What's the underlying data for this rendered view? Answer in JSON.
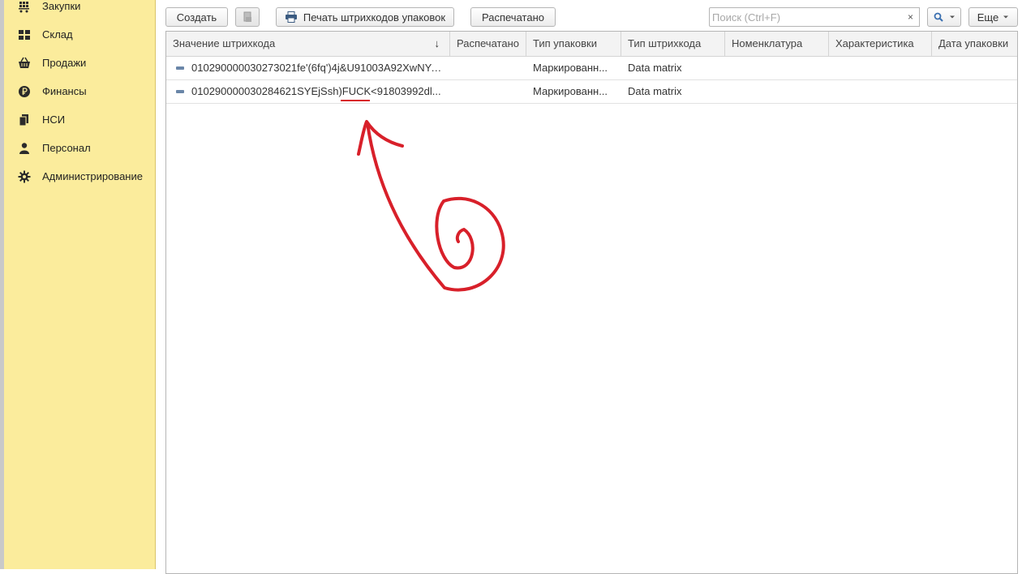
{
  "sidebar": {
    "items": [
      {
        "label": "Закупки",
        "icon": "cart-icon"
      },
      {
        "label": "Склад",
        "icon": "warehouse-icon"
      },
      {
        "label": "Продажи",
        "icon": "basket-icon"
      },
      {
        "label": "Финансы",
        "icon": "ruble-icon"
      },
      {
        "label": "НСИ",
        "icon": "books-icon"
      },
      {
        "label": "Персонал",
        "icon": "person-icon"
      },
      {
        "label": "Администрирование",
        "icon": "gear-icon"
      }
    ]
  },
  "toolbar": {
    "create_label": "Создать",
    "print_barcodes_label": "Печать штрихкодов упаковок",
    "printed_label": "Распечатано",
    "search_placeholder": "Поиск (Ctrl+F)",
    "search_clear_label": "×",
    "more_label": "Еще"
  },
  "table": {
    "columns": [
      "Значение штрихкода",
      "Распечатано",
      "Тип упаковки",
      "Тип штрихкода",
      "Номенклатура",
      "Характеристика",
      "Дата упаковки"
    ],
    "sort_indicator": "↓",
    "rows": [
      {
        "barcode": "010290000030273021fe'(6fq')4j&U91003A92XwNYp...",
        "printed": "",
        "package_type": "Маркированн...",
        "barcode_type": "Data matrix",
        "nomenclature": "",
        "characteristic": "",
        "pack_date": ""
      },
      {
        "barcode_prefix": "010290000030284621SYEjSsh)",
        "barcode_highlight": "FUCK",
        "barcode_suffix": "<91803992dl...",
        "printed": "",
        "package_type": "Маркированн...",
        "barcode_type": "Data matrix",
        "nomenclature": "",
        "characteristic": "",
        "pack_date": ""
      }
    ]
  },
  "annotation": {
    "color": "#d8202a",
    "shape": "hand-drawn-arrow-spiral"
  },
  "colors": {
    "sidebar_bg": "#fbec9c",
    "accent": "#3a6fb0"
  }
}
